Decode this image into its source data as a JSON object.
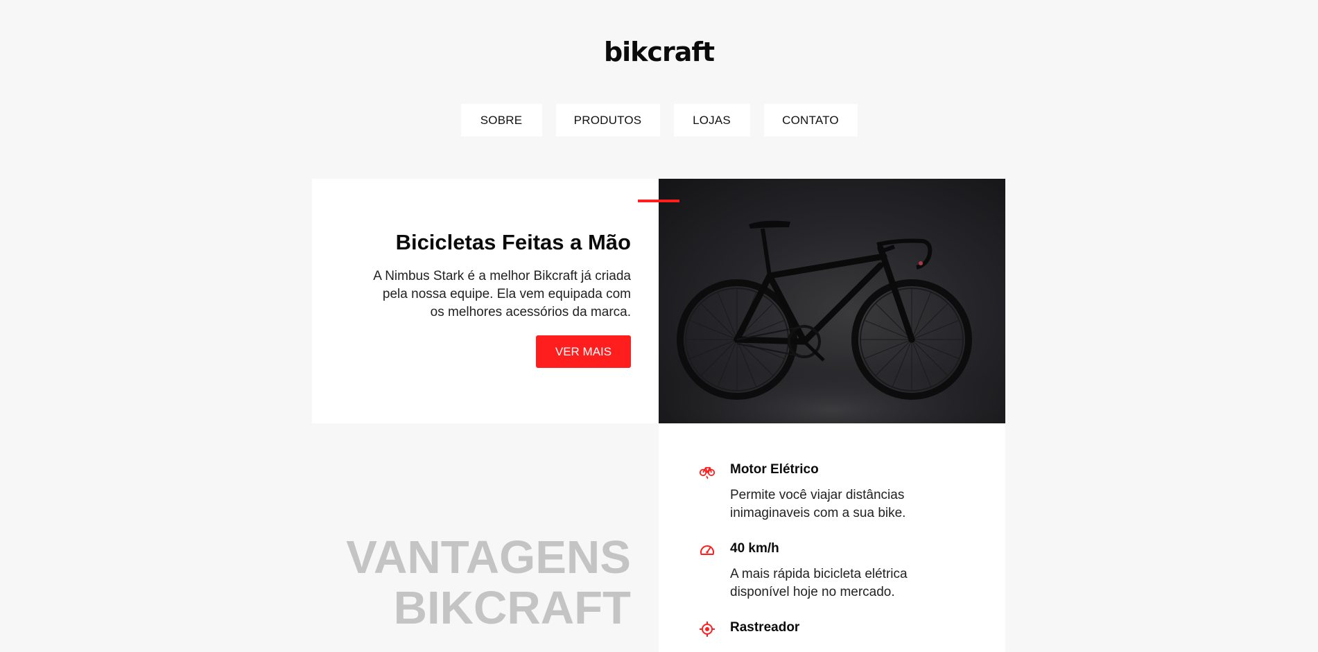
{
  "header": {
    "logo": "bikcraft"
  },
  "nav": {
    "items": [
      {
        "label": "SOBRE"
      },
      {
        "label": "PRODUTOS"
      },
      {
        "label": "LOJAS"
      },
      {
        "label": "CONTATO"
      }
    ]
  },
  "hero": {
    "title": "Bicicletas Feitas a Mão",
    "description": "A Nimbus Stark é a melhor Bikcraft já criada pela nossa equipe. Ela vem equipada com os melhores acessórios da marca.",
    "button_label": "VER MAIS",
    "image_subject": "bicycle-photo"
  },
  "advantages": {
    "title_line1": "VANTAGENS",
    "title_line2": "BIKCRAFT",
    "items": [
      {
        "icon": "electric-bike-icon",
        "title": "Motor Elétrico",
        "description": "Permite você viajar distâncias inimaginaveis com a sua bike."
      },
      {
        "icon": "speedometer-icon",
        "title": "40 km/h",
        "description": "A mais rápida bicicleta elétrica disponível hoje no mercado."
      },
      {
        "icon": "tracker-icon",
        "title": "Rastreador",
        "description": ""
      }
    ]
  },
  "colors": {
    "accent": "#ff1e1e",
    "background": "#f7f7f7",
    "card": "#ffffff",
    "muted_heading": "#c4c4c4"
  }
}
